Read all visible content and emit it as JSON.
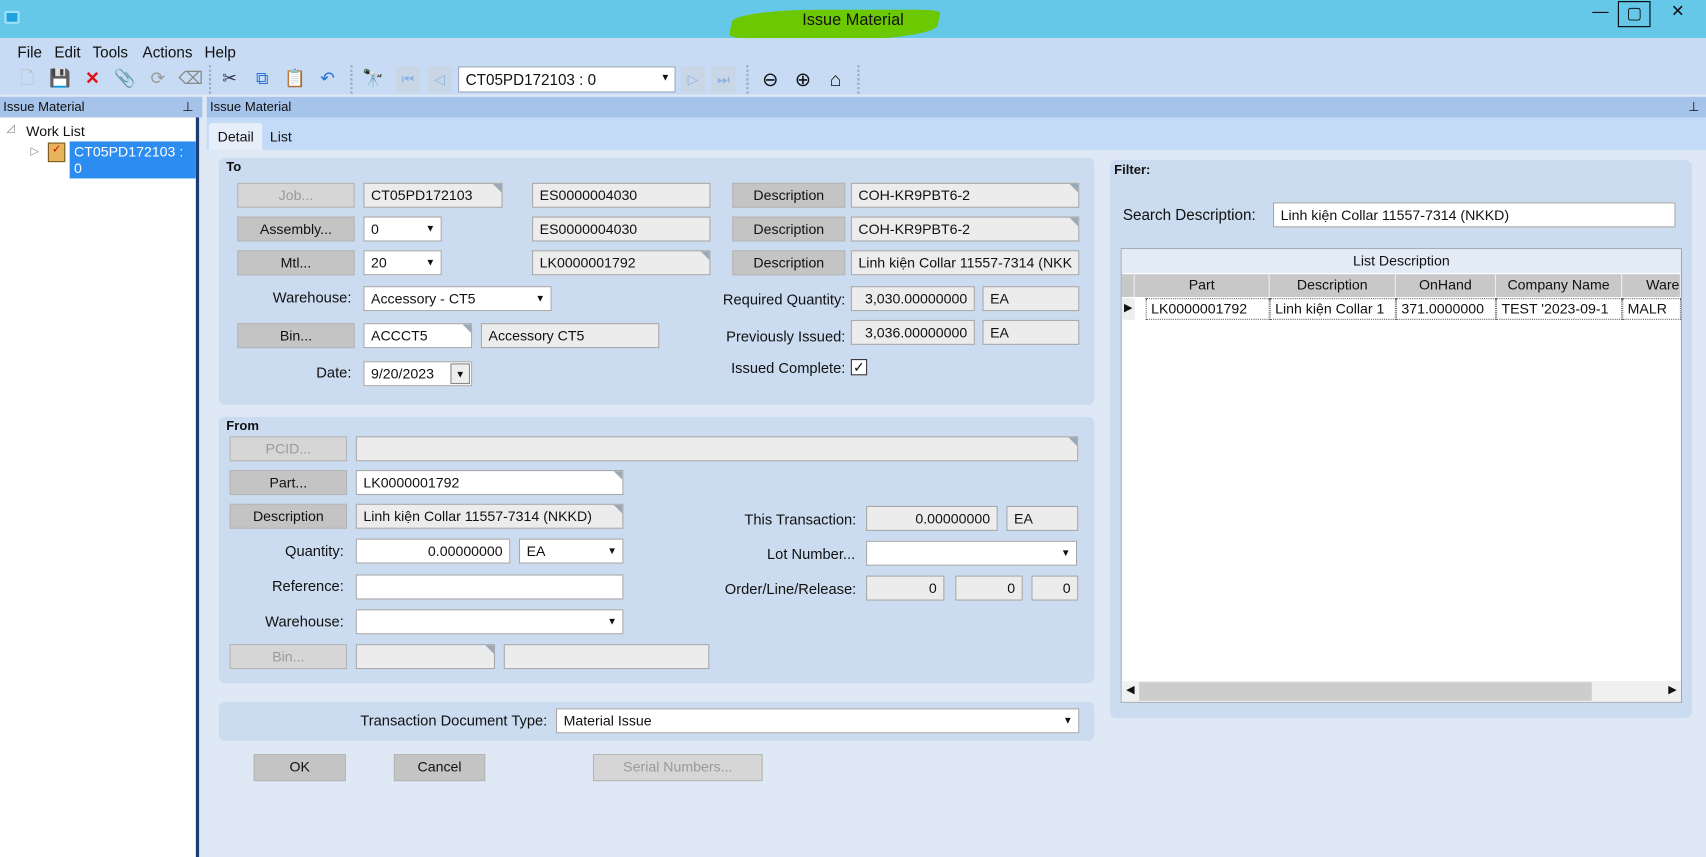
{
  "window": {
    "title": "Issue Material",
    "minimize": "—",
    "maximize": "▢",
    "close": "✕"
  },
  "menu": [
    "File",
    "Edit",
    "Tools",
    "Actions",
    "Help"
  ],
  "toolbar": {
    "record_value": "CT05PD172103 : 0"
  },
  "left_panel": {
    "title": "Issue Material",
    "tree_root": "Work List",
    "tree_item": "CT05PD172103 : 0"
  },
  "main_panel": {
    "title": "Issue Material",
    "tabs": [
      "Detail",
      "List"
    ]
  },
  "to": {
    "title": "To",
    "job_btn": "Job...",
    "job": "CT05PD172103",
    "job_es": "ES0000004030",
    "desc_btn": "Description",
    "job_desc": "COH-KR9PBT6-2",
    "assembly_btn": "Assembly...",
    "assembly": "0",
    "asm_es": "ES0000004030",
    "asm_desc": "COH-KR9PBT6-2",
    "mtl_btn": "Mtl...",
    "mtl": "20",
    "mtl_part": "LK0000001792",
    "mtl_desc": "Linh kiện Collar 11557-7314 (NKK",
    "warehouse_label": "Warehouse:",
    "warehouse": "Accessory - CT5",
    "req_qty_label": "Required Quantity:",
    "req_qty": "3,030.00000000",
    "req_uom": "EA",
    "bin_btn": "Bin...",
    "bin": "ACCCT5",
    "bin_desc": "Accessory CT5",
    "prev_label": "Previously Issued:",
    "prev_qty": "3,036.00000000",
    "prev_uom": "EA",
    "date_label": "Date:",
    "date": "9/20/2023",
    "issued_complete_label": "Issued Complete:",
    "issued_complete": true
  },
  "from": {
    "title": "From",
    "pcid_btn": "PCID...",
    "pcid": "",
    "part_btn": "Part...",
    "part": "LK0000001792",
    "desc_btn": "Description",
    "desc": "Linh kiện Collar 11557-7314 (NKKD)",
    "this_tx_label": "This Transaction:",
    "this_tx": "0.00000000",
    "this_tx_uom": "EA",
    "qty_label": "Quantity:",
    "qty": "0.00000000",
    "qty_uom": "EA",
    "lot_label": "Lot Number...",
    "lot": "",
    "ref_label": "Reference:",
    "ref": "",
    "olr_label": "Order/Line/Release:",
    "order": "0",
    "line": "0",
    "release": "0",
    "warehouse_label": "Warehouse:",
    "warehouse": "",
    "bin_btn": "Bin...",
    "bin": "",
    "bin_desc": ""
  },
  "trans_doc": {
    "label": "Transaction Document Type:",
    "value": "Material Issue"
  },
  "buttons": {
    "ok": "OK",
    "cancel": "Cancel",
    "serial": "Serial Numbers..."
  },
  "filter": {
    "title": "Filter:",
    "search_label": "Search Description:",
    "search_value": "Linh kiện Collar 11557-7314 (NKKD)",
    "grid_title": "List Description",
    "columns": [
      "Part",
      "Description",
      "OnHand",
      "Company Name",
      "Ware"
    ],
    "rows": [
      [
        "LK0000001792",
        "Linh kiện Collar 1",
        "371.0000000",
        "TEST '2023-09-1",
        "MALR"
      ]
    ]
  }
}
